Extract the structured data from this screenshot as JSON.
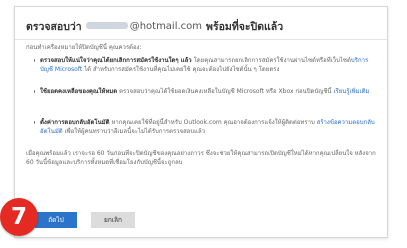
{
  "dialog": {
    "title_prefix": "ตรวจสอบว่า",
    "title_email": "@hotmail.com",
    "title_suffix": "พร้อมที่จะปิดแล้ว",
    "intro": "ก่อนทำเครื่องหมายให้ปิดบัญชีนี้ คุณควรต้อง:",
    "bullets": [
      {
        "strong": "ตรวจสอบให้แน่ใจว่าคุณได้ยกเลิกการสมัครใช้งานใดๆ แล้ว",
        "text": " โดยคุณสามารถยกเลิกการสมัครใช้งานผ่านไซต์หรือที่เว็บไซต์",
        "link": "บริการบัญชี Microsoft",
        "text2": " ได้ สำหรับการสมัครใช้งานที่คุณไม่เคยใช้ คุณจะต้องไปยังไซต์นั้น ๆ โดยตรง"
      },
      {
        "strong": "ใช้ยอดคงเหลือของคุณให้หมด",
        "text": " ตรวจสอบว่าคุณได้ใช้ยอดเงินคงเหลือในบัญชี Microsoft หรือ Xbox ก่อนปิดบัญชีนี้ ",
        "link": "เรียนรู้เพิ่มเติม",
        "text2": ""
      },
      {
        "strong": "ตั้งค่าการตอบกลับอัตโนมัติ",
        "text": " หากคุณเคยใช้ที่อยู่นี้สำหรับ Outlook.com คุณอาจต้องการแจ้งให้ผู้ติดต่อทราบ ",
        "link": "สร้างข้อความตอบกลับอัตโนมัติ",
        "text2": " เพื่อให้ผู้คนทราบว่าอีเมลนี้จะไม่ได้รับการตรวจสอบแล้ว"
      }
    ],
    "outro": "เมื่อคุณพร้อมแล้ว เราจะรอ 60 วันก่อนที่จะปิดบัญชีของคุณอย่างถาวร ซึ่งจะช่วยให้คุณสามารถเปิดบัญชีใหม่ได้หากคุณเปลี่ยนใจ หลังจาก 60 วันนี้ข้อมูลและบริการทั้งหมดที่เชื่อมโยงกับบัญชีนี้จะถูกลบ",
    "buttons": {
      "next_label": "ถัดไป",
      "cancel_label": "ยกเลิก"
    }
  },
  "step_badge": "7",
  "colors": {
    "primary": "#2b74c9",
    "badge": "#e52a24",
    "link": "#2a6fc9"
  }
}
